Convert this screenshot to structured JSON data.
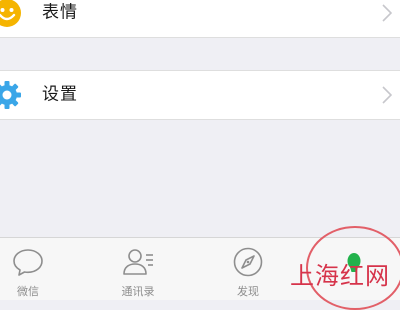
{
  "menu": {
    "items": [
      {
        "label": "表情",
        "icon": "smiley-face-icon",
        "accent": "#f5b400"
      },
      {
        "label": "设置",
        "icon": "gear-icon",
        "accent": "#3aa6e8"
      }
    ]
  },
  "tabbar": {
    "tabs": [
      {
        "label": "微信",
        "icon": "chat-bubble-icon"
      },
      {
        "label": "通讯录",
        "icon": "contacts-icon"
      },
      {
        "label": "发现",
        "icon": "compass-icon"
      },
      {
        "label": "",
        "icon": "person-icon",
        "active": true,
        "active_color": "#22b24c"
      }
    ]
  },
  "annotation": {
    "highlight_color": "#e25f68"
  },
  "watermark": {
    "text": "上海红网"
  }
}
